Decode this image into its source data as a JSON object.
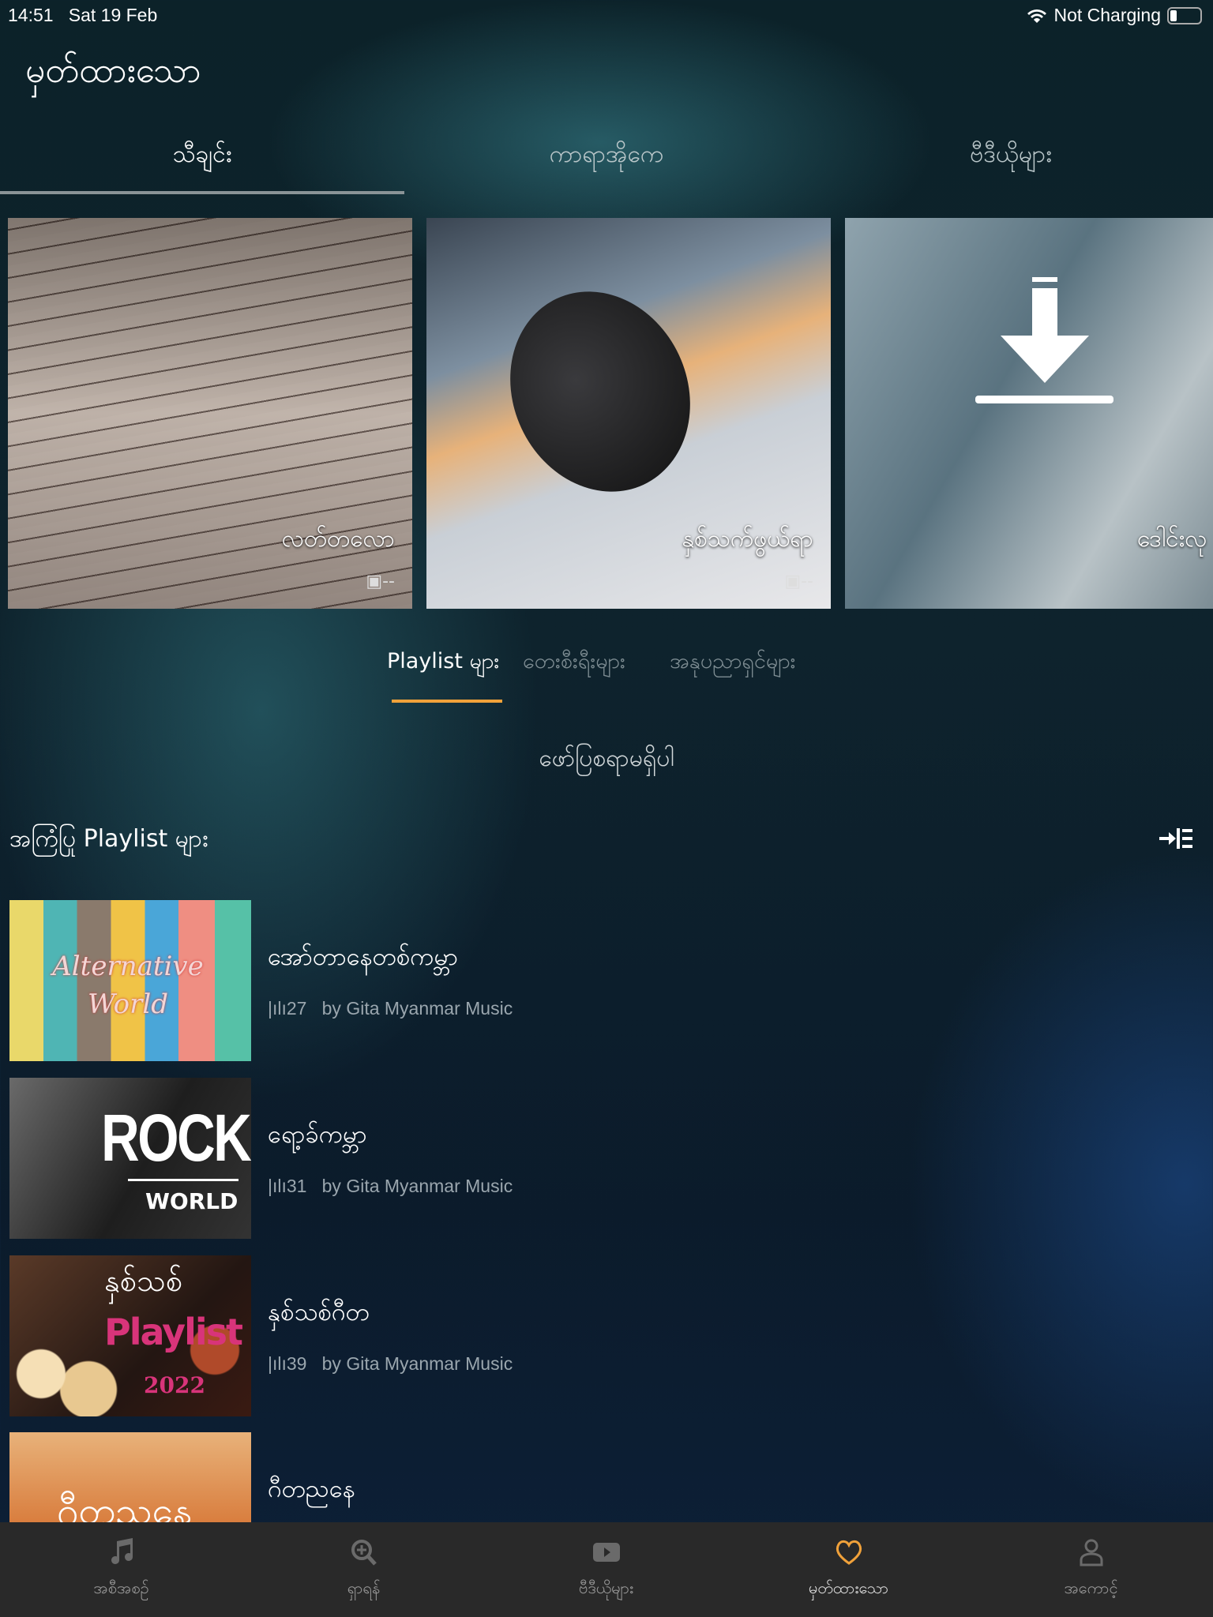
{
  "status": {
    "time": "14:51",
    "date": "Sat 19 Feb",
    "charging": "Not Charging",
    "battery_level": 0.1
  },
  "header": {
    "title": "မှတ်ထားသော"
  },
  "tabs": [
    {
      "label": "သီချင်း",
      "active": true
    },
    {
      "label": "ကာရာအိုကေ"
    },
    {
      "label": "ဗီဒီယိုများ"
    }
  ],
  "cards": [
    {
      "label": "လတ်တလော",
      "count": "--"
    },
    {
      "label": "နှစ်သက်ဖွယ်ရာ",
      "count": "--"
    },
    {
      "label": "ဒေါင်းလု",
      "count": ""
    }
  ],
  "subtabs": [
    {
      "label": "Playlist များ",
      "active": true
    },
    {
      "label": "တေးစီးရီးများ"
    },
    {
      "label": "အနုပညာရှင်များ"
    }
  ],
  "empty": "ဖော်ပြစရာမရှိပါ",
  "section": {
    "title": "အကြံပြု Playlist များ"
  },
  "playlists": [
    {
      "title": "အော်တာနေတစ်ကမ္ဘာ",
      "count": "27",
      "by": "by Gita Myanmar Music",
      "art": "Alternative World"
    },
    {
      "title": "ရော့ခ်ကမ္ဘာ",
      "count": "31",
      "by": "by Gita Myanmar Music",
      "art": "ROCK",
      "art2": "WORLD"
    },
    {
      "title": "နှစ်သစ်ဂီတ",
      "count": "39",
      "by": "by Gita Myanmar Music",
      "art": "နှစ်သစ်",
      "art2": "Playlist",
      "art3": "2022"
    },
    {
      "title": "ဂီတညနေ",
      "art": "ဂီတညနေ"
    }
  ],
  "nav": [
    {
      "label": "အစီအစဉ်",
      "icon": "music-note-icon"
    },
    {
      "label": "ရှာရန်",
      "icon": "search-icon"
    },
    {
      "label": "ဗီဒီယိုများ",
      "icon": "play-icon"
    },
    {
      "label": "မှတ်ထားသော",
      "icon": "heart-icon",
      "active": true
    },
    {
      "label": "အကောင့်",
      "icon": "user-icon"
    }
  ],
  "colors": {
    "accent": "#f0a13a",
    "nav_bg": "#292929"
  }
}
